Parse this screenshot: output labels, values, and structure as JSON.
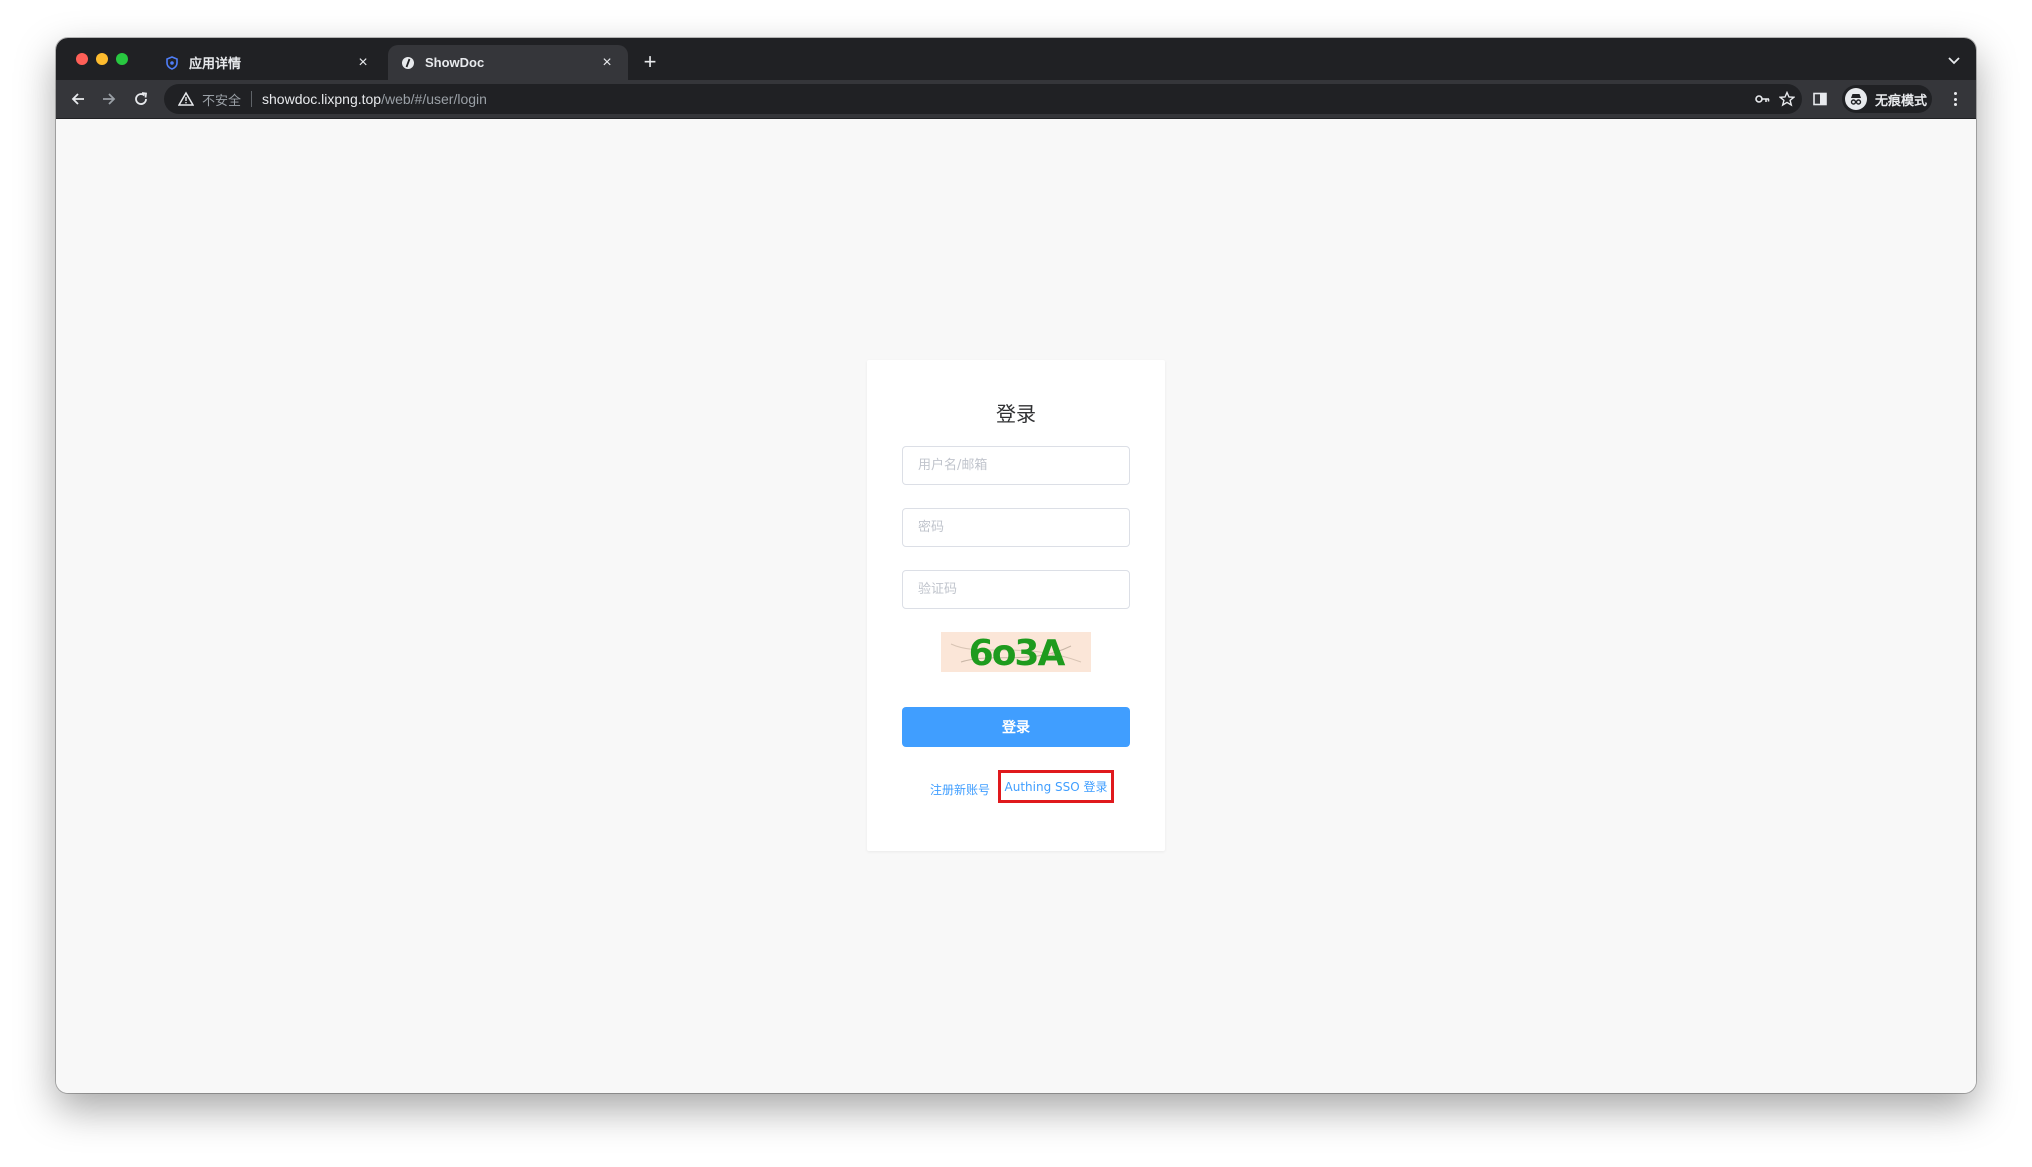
{
  "browser": {
    "tabs": [
      {
        "title": "应用详情",
        "icon": "shield-icon",
        "active": false
      },
      {
        "title": "ShowDoc",
        "icon": "showdoc-logo-icon",
        "active": true
      }
    ],
    "new_tab": "+",
    "close_glyph": "×",
    "security_label": "不安全",
    "url_host": "showdoc.lixpng.top",
    "url_path": "/web/#/user/login",
    "profile_label": "无痕模式"
  },
  "login": {
    "title": "登录",
    "username_placeholder": "用户名/邮箱",
    "password_placeholder": "密码",
    "captcha_placeholder": "验证码",
    "captcha_text": "6o3A",
    "submit_label": "登录",
    "register_link": "注册新账号",
    "sso_link": "Authing SSO 登录"
  },
  "colors": {
    "primary": "#409eff",
    "highlight_border": "#e0191d",
    "captcha_text": "#1e9b1e",
    "captcha_bg": "#fbe6d8"
  }
}
